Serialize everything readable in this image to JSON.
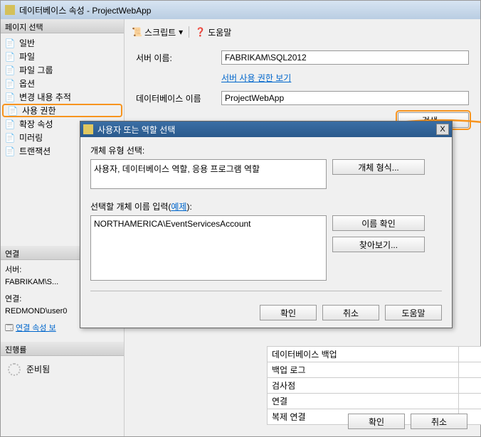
{
  "window": {
    "title": "데이터베이스 속성 - ProjectWebApp"
  },
  "sidebar": {
    "header": "페이지 선택",
    "items": [
      {
        "label": "일반"
      },
      {
        "label": "파일"
      },
      {
        "label": "파일 그룹"
      },
      {
        "label": "옵션"
      },
      {
        "label": "변경 내용 추적"
      },
      {
        "label": "사용 권한"
      },
      {
        "label": "확장 속성"
      },
      {
        "label": "미러링"
      },
      {
        "label": "트랜잭션"
      }
    ],
    "conn_header": "연결",
    "server_lbl": "서버:",
    "server_val": "FABRIKAM\\S...",
    "conn_lbl": "연결:",
    "conn_val": "REDMOND\\user0",
    "conn_props": "연결 속성 보",
    "progress_header": "진행률",
    "progress_text": "준비됨"
  },
  "toolbar": {
    "script": "스크립트",
    "help": "도움말"
  },
  "main": {
    "server_name_lbl": "서버 이름:",
    "server_name_val": "FABRIKAM\\SQL2012",
    "view_server_perm": "서버 사용 권한 보기",
    "db_name_lbl": "데이터베이스 이름",
    "db_name_val": "ProjectWebApp",
    "search_btn": "검색..."
  },
  "grid": {
    "rows": [
      "데이터베이스 백업",
      "백업 로그",
      "검사점",
      "연결",
      "복제 연결"
    ]
  },
  "footer": {
    "ok": "확인",
    "cancel": "취소"
  },
  "dialog": {
    "title": "사용자 또는 역할 선택",
    "obj_type_lbl": "개체 유형 선택:",
    "obj_type_val": "사용자, 데이터베이스 역할, 응용 프로그램 역할",
    "obj_type_btn": "개체 형식...",
    "names_lbl_prefix": "선택할 개체 이름 입력(",
    "names_lbl_link": "예제",
    "names_lbl_suffix": "):",
    "names_val": "NORTHAMERICA\\EventServicesAccount",
    "check_names_btn": "이름 확인",
    "browse_btn": "찾아보기...",
    "ok": "확인",
    "cancel": "취소",
    "help": "도움말",
    "close": "X"
  }
}
